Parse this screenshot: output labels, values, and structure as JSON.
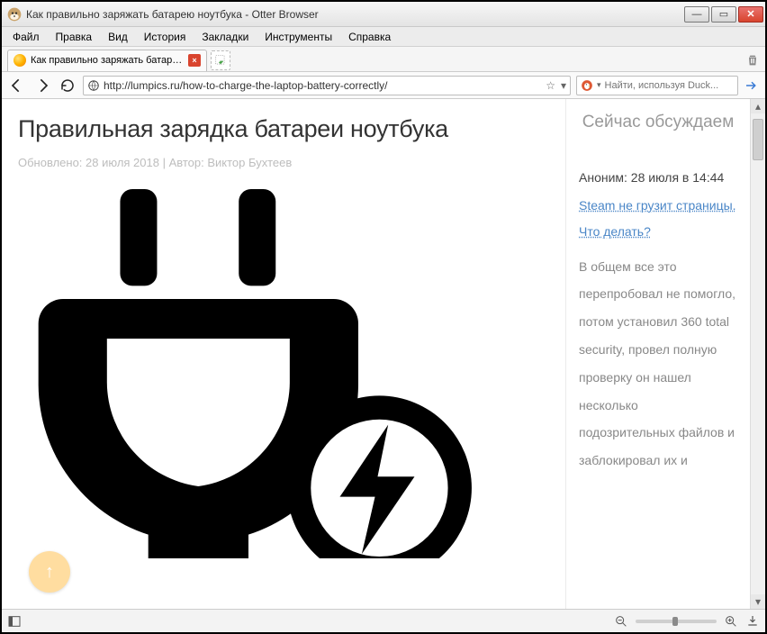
{
  "window": {
    "title": "Как правильно заряжать батарею ноутбука - Otter Browser"
  },
  "menubar": {
    "items": [
      "Файл",
      "Правка",
      "Вид",
      "История",
      "Закладки",
      "Инструменты",
      "Справка"
    ]
  },
  "tabs": [
    {
      "title": "Как правильно заряжать батарею но..."
    }
  ],
  "nav": {
    "url": "http://lumpics.ru/how-to-charge-the-laptop-battery-correctly/",
    "search_placeholder": "Найти, используя Duck..."
  },
  "article": {
    "title": "Правильная зарядка батареи ноутбука",
    "meta": "Обновлено: 28 июля 2018 | Автор: Виктор Бухтеев"
  },
  "sidebar": {
    "heading": "Сейчас обсуждаем",
    "comment_author": "Аноним: 28 июля в 14:44",
    "comment_link": "Steam не грузит страницы. Что делать?",
    "comment_body": "В общем все это перепробовал не помогло, потом установил 360 total security, провел полную проверку он нашел несколько подозрительных файлов и заблокировал их и"
  }
}
